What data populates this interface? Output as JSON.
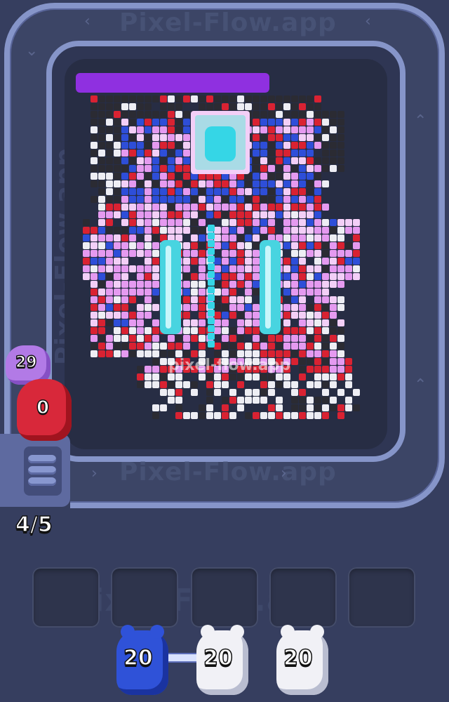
{
  "watermark": "Pixel-Flow.app",
  "watermark_board": "pixel-flow.app",
  "conveyor": {
    "active_pigs": [
      {
        "color": "purple",
        "ammo": "29"
      },
      {
        "color": "red",
        "ammo": "0"
      }
    ],
    "queue_count": "4/5"
  },
  "tray": {
    "slots": [
      {
        "label": "empty-slot-1"
      },
      {
        "label": "empty-slot-2"
      },
      {
        "label": "empty-slot-3"
      },
      {
        "label": "empty-slot-4"
      },
      {
        "label": "empty-slot-5"
      }
    ]
  },
  "shooters": [
    {
      "color": "blue",
      "ammo": "20"
    },
    {
      "color": "white",
      "ammo": "20"
    },
    {
      "color": "white",
      "ammo": "20"
    }
  ],
  "colors": {
    "black": "#2b2b33",
    "red": "#d92232",
    "blue": "#2e4ed8",
    "pink": "#e59af0",
    "lavender": "#f3cff7",
    "white": "#eeeef4",
    "cyan": "#35d6e6",
    "purple": "#8f30e0",
    "background": "#363e5f",
    "belt": "#8695c9"
  },
  "icons": [
    "chevron-left-icon",
    "chevron-right-icon",
    "chevron-up-icon",
    "chevron-down-icon",
    "pig-icon"
  ]
}
